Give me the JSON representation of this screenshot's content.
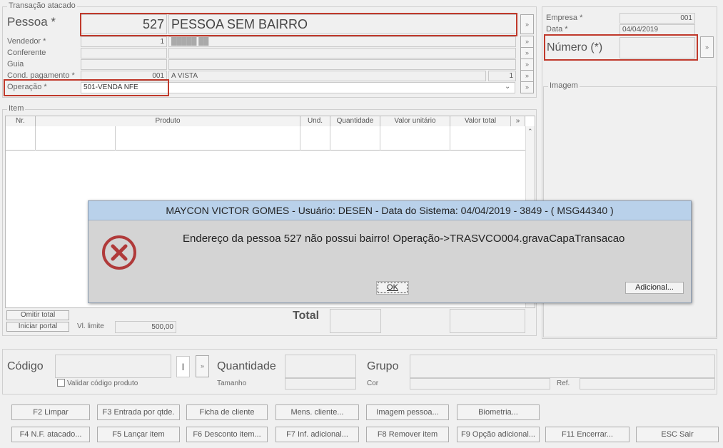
{
  "transacao": {
    "legend": "Transação atacado",
    "pessoa_label": "Pessoa *",
    "pessoa_code": "527",
    "pessoa_name": "PESSOA SEM BAIRRO",
    "vendedor_label": "Vendedor *",
    "vendedor_code": "1",
    "vendedor_name": "█████ ██",
    "conferente_label": "Conferente",
    "guia_label": "Guia",
    "cond_label": "Cond. pagamento *",
    "cond_code": "001",
    "cond_name": "A VISTA",
    "cond_parcelas": "1",
    "operacao_label": "Operação *",
    "operacao_value": "501-VENDA NFE"
  },
  "empresa": {
    "empresa_label": "Empresa *",
    "empresa_value": "001",
    "data_label": "Data *",
    "data_value": "04/04/2019",
    "numero_label": "Número (*)",
    "imagem_legend": "Imagem"
  },
  "item": {
    "legend": "Item",
    "columns": [
      "Nr.",
      "Produto",
      "Und.",
      "Quantidade",
      "Valor unitário",
      "Valor total"
    ],
    "omitir_total": "Omitir total",
    "iniciar_portal": "Iniciar portal",
    "vl_limite_label": "Vl. limite",
    "vl_limite_value": "500,00",
    "total_label": "Total"
  },
  "bottom": {
    "codigo_label": "Código",
    "codigo_mode": "I",
    "validar_label": "Validar código produto",
    "quantidade_label": "Quantidade",
    "tamanho_label": "Tamanho",
    "grupo_label": "Grupo",
    "cor_label": "Cor",
    "ref_label": "Ref."
  },
  "buttons_row1": [
    "F2 Limpar",
    "F3 Entrada por qtde.",
    "Ficha de cliente",
    "Mens. cliente...",
    "Imagem pessoa...",
    "Biometria..."
  ],
  "buttons_row2": [
    "F4 N.F. atacado...",
    "F5 Lançar item",
    "F6 Desconto item...",
    "F7 Inf. adicional...",
    "F8 Remover item",
    "F9 Opção adicional...",
    "F11 Encerrar...",
    "ESC Sair"
  ],
  "dialog": {
    "title": "MAYCON VICTOR GOMES - Usuário: DESEN - Data do Sistema: 04/04/2019 - 3849 - ( MSG44340 )",
    "message": "Endereço da pessoa 527 não possui bairro! Operação->TRASVCO004.gravaCapaTransacao",
    "ok_label": "OK",
    "adicional_label": "Adicional..."
  },
  "colors": {
    "highlight": "#c0392b",
    "dialog_title_bg": "#b9d1ea",
    "error_icon": "#b03a3a"
  }
}
